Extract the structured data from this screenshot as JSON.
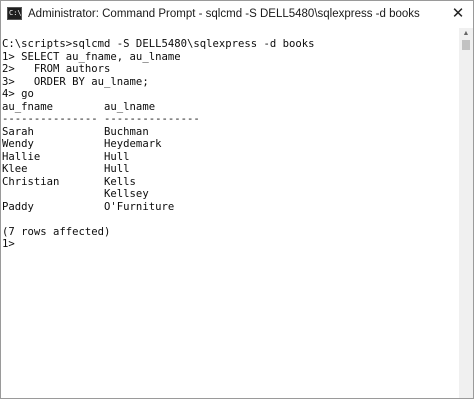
{
  "window": {
    "title": "Administrator: Command Prompt - sqlcmd  -S DELL5480\\sqlexpress -d books",
    "icon_text": "C:\\",
    "close_label": "✕"
  },
  "console": {
    "lines": [
      "C:\\scripts>sqlcmd -S DELL5480\\sqlexpress -d books",
      "1> SELECT au_fname, au_lname",
      "2>   FROM authors",
      "3>   ORDER BY au_lname;",
      "4> go",
      "au_fname        au_lname",
      "--------------- ---------------",
      "Sarah           Buchman",
      "Wendy           Heydemark",
      "Hallie          Hull",
      "Klee            Hull",
      "Christian       Kells",
      "                Kellsey",
      "Paddy           O'Furniture",
      "",
      "(7 rows affected)",
      "1>"
    ]
  },
  "scrollbar": {
    "up_arrow": "▲"
  }
}
